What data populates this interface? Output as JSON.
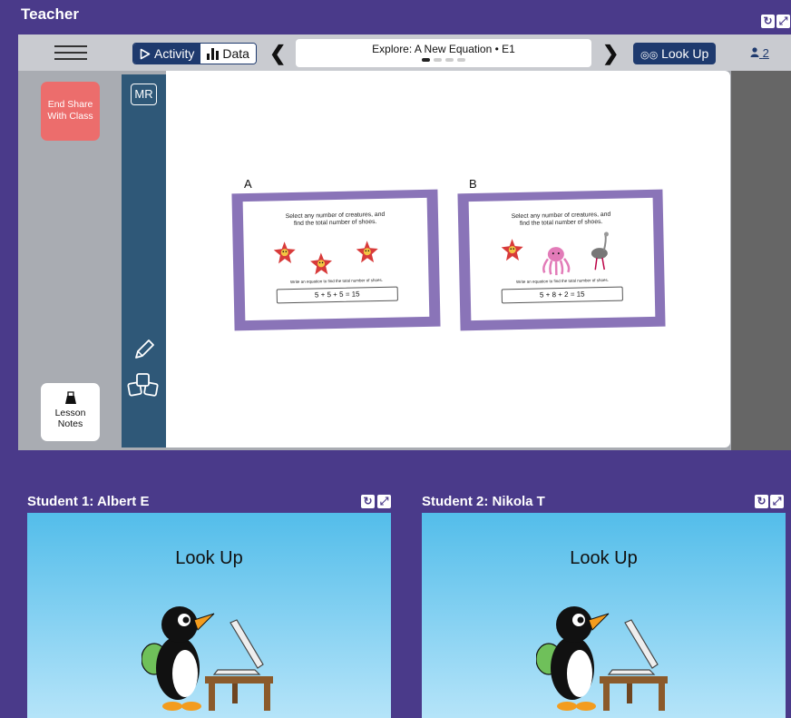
{
  "teacher": {
    "title": "Teacher",
    "refresh_icon": "refresh-icon",
    "expand_icon": "expand-icon"
  },
  "toolbar": {
    "menu_icon": "hamburger-menu-icon",
    "activity_label": "Activity",
    "data_label": "Data",
    "screen_title": "Explore: A New Equation • E1",
    "screen_count": 4,
    "current_screen": 1,
    "look_up_label": "Look Up",
    "user_count": "2"
  },
  "sidebar": {
    "end_share_line1": "End Share",
    "end_share_line2": "With Class",
    "lesson_notes_line1": "Lesson",
    "lesson_notes_line2": "Notes",
    "mr_label": "MR"
  },
  "cards": [
    {
      "label": "A",
      "instructions_line1": "Select any number of creatures, and",
      "instructions_line2": "find the total number of shoes.",
      "equation_label": "Write an equation to find the total number of shoes.",
      "equation": "5 + 5 + 5 = 15",
      "creatures": [
        "starfish",
        "starfish",
        "starfish"
      ]
    },
    {
      "label": "B",
      "instructions_line1": "Select any number of creatures, and",
      "instructions_line2": "find the total number of shoes.",
      "equation_label": "Write an equation to find the total number of shoes.",
      "equation": "5 + 8 + 2 = 15",
      "creatures": [
        "starfish",
        "octopus",
        "ostrich"
      ]
    }
  ],
  "students": [
    {
      "title": "Student 1: Albert E",
      "screen_text": "Look Up"
    },
    {
      "title": "Student 2: Nikola T",
      "screen_text": "Look Up"
    }
  ],
  "colors": {
    "background": "#4a3a8a",
    "navy": "#1e3a6e",
    "end_share": "#ec6d6c",
    "card_border": "#8a74b8"
  }
}
